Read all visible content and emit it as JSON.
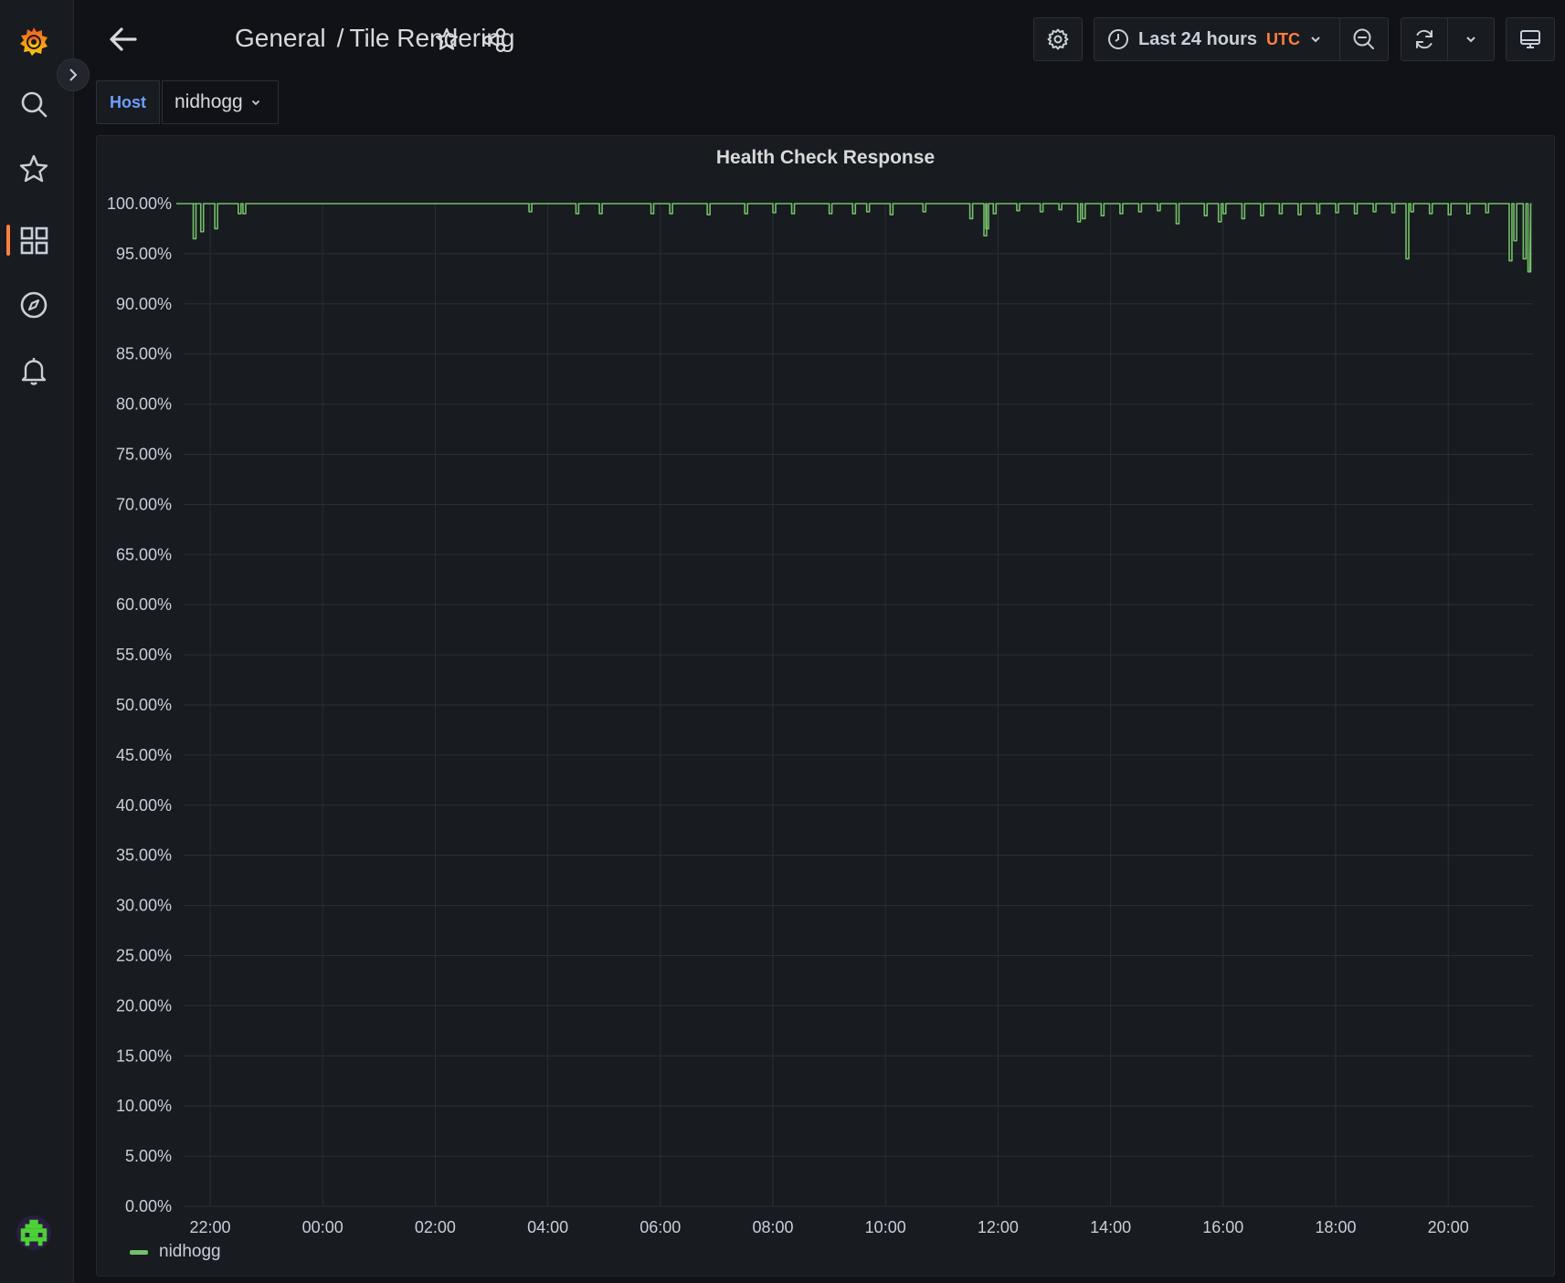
{
  "nav": {
    "items": [
      "grafana-logo",
      "search",
      "starred",
      "dashboards",
      "explore",
      "alerting"
    ]
  },
  "header": {
    "breadcrumb_folder": "General",
    "breadcrumb_separator": "/",
    "breadcrumb_dashboard": "Tile Rendering",
    "time_range_label": "Last 24 hours",
    "timezone_label": "UTC"
  },
  "variables": {
    "host_label": "Host",
    "host_value": "nidhogg"
  },
  "panel": {
    "title": "Health Check Response"
  },
  "colors": {
    "series": "#73bf69",
    "accent": "#ff7f3f",
    "variable_label": "#6e9fff"
  },
  "chart_data": {
    "type": "line",
    "title": "Health Check Response",
    "x_ticks": [
      "22:00",
      "00:00",
      "02:00",
      "04:00",
      "06:00",
      "08:00",
      "10:00",
      "12:00",
      "14:00",
      "16:00",
      "18:00",
      "20:00"
    ],
    "y_ticks": [
      "100.00%",
      "95.00%",
      "90.00%",
      "85.00%",
      "80.00%",
      "75.00%",
      "70.00%",
      "65.00%",
      "60.00%",
      "55.00%",
      "50.00%",
      "45.00%",
      "40.00%",
      "35.00%",
      "30.00%",
      "25.00%",
      "20.00%",
      "15.00%",
      "10.00%",
      "5.00%",
      "0.00%"
    ],
    "ylim": [
      0,
      100
    ],
    "grid": true,
    "legend_placement": "bottom-left",
    "series": [
      {
        "name": "nidhogg",
        "color": "#73bf69",
        "x": [
          "21:40",
          "21:42",
          "21:44",
          "21:50",
          "22:00",
          "22:05",
          "22:10",
          "22:30",
          "22:35",
          "22:40",
          "03:40",
          "03:42",
          "04:30",
          "04:55",
          "05:50",
          "06:10",
          "06:50",
          "07:30",
          "08:00",
          "08:20",
          "09:00",
          "09:25",
          "09:40",
          "10:05",
          "10:40",
          "11:30",
          "11:45",
          "11:47",
          "11:55",
          "12:20",
          "12:45",
          "13:05",
          "13:25",
          "13:30",
          "13:50",
          "14:10",
          "14:30",
          "14:50",
          "15:10",
          "15:40",
          "15:55",
          "16:00",
          "16:20",
          "16:40",
          "17:00",
          "17:20",
          "17:40",
          "18:00",
          "18:20",
          "18:40",
          "19:00",
          "19:15",
          "19:20",
          "19:40",
          "20:00",
          "20:20",
          "20:40",
          "20:55",
          "21:05",
          "21:10",
          "21:20",
          "21:25"
        ],
        "y": [
          100,
          96.5,
          100,
          97.2,
          100,
          97.5,
          100,
          99,
          99,
          100,
          99.2,
          100,
          99,
          99,
          99,
          99,
          98.9,
          99,
          99.1,
          99,
          99,
          99,
          99.2,
          98.9,
          99.2,
          98.5,
          96.8,
          97.5,
          99,
          99.3,
          99.2,
          99.4,
          98.2,
          98.5,
          98.8,
          99,
          99.2,
          99.3,
          98,
          98.8,
          98.2,
          99,
          98.5,
          98.8,
          99,
          98.9,
          99,
          99.1,
          99,
          99.2,
          99.1,
          94.5,
          99.2,
          99,
          98.9,
          99,
          99.1,
          100,
          94.3,
          96.3,
          94.5,
          93.2
        ]
      }
    ]
  }
}
